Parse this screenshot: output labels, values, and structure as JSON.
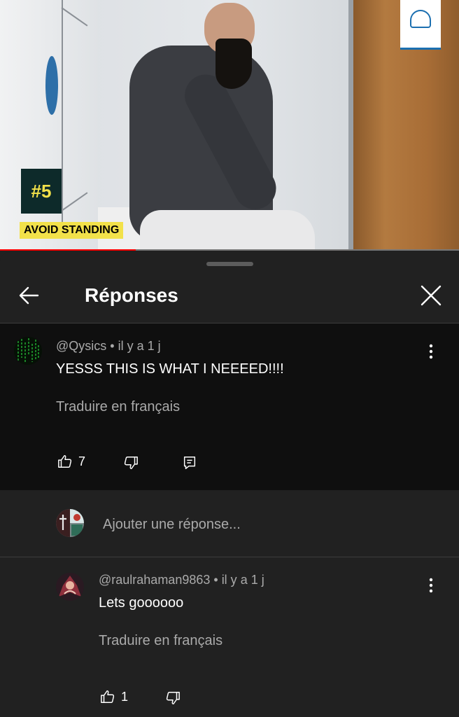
{
  "video": {
    "badge_number": "#5",
    "badge_label": "AVOID STANDING",
    "progress_fraction": 0.295,
    "progress_color": "#ff0000"
  },
  "panel": {
    "title": "Réponses",
    "back_icon": "arrow-left-icon",
    "close_icon": "close-icon"
  },
  "comments": [
    {
      "author": "@Qysics",
      "age": "il y a 1 j",
      "text": "YESSS THIS IS WHAT I NEEEED!!!!",
      "translate": "Traduire en français",
      "likes": "7"
    },
    {
      "author": "@raulrahaman9863",
      "age": "il y a 1 j",
      "text": "Lets goooooo",
      "translate": "Traduire en français",
      "likes": "1"
    }
  ],
  "reply_box": {
    "placeholder": "Ajouter une réponse..."
  },
  "colors": {
    "panel_bg": "#212121",
    "highlight_bg": "#0f0f0f",
    "secondary_text": "#aaaaaa",
    "badge_yellow": "#f2e14a"
  }
}
